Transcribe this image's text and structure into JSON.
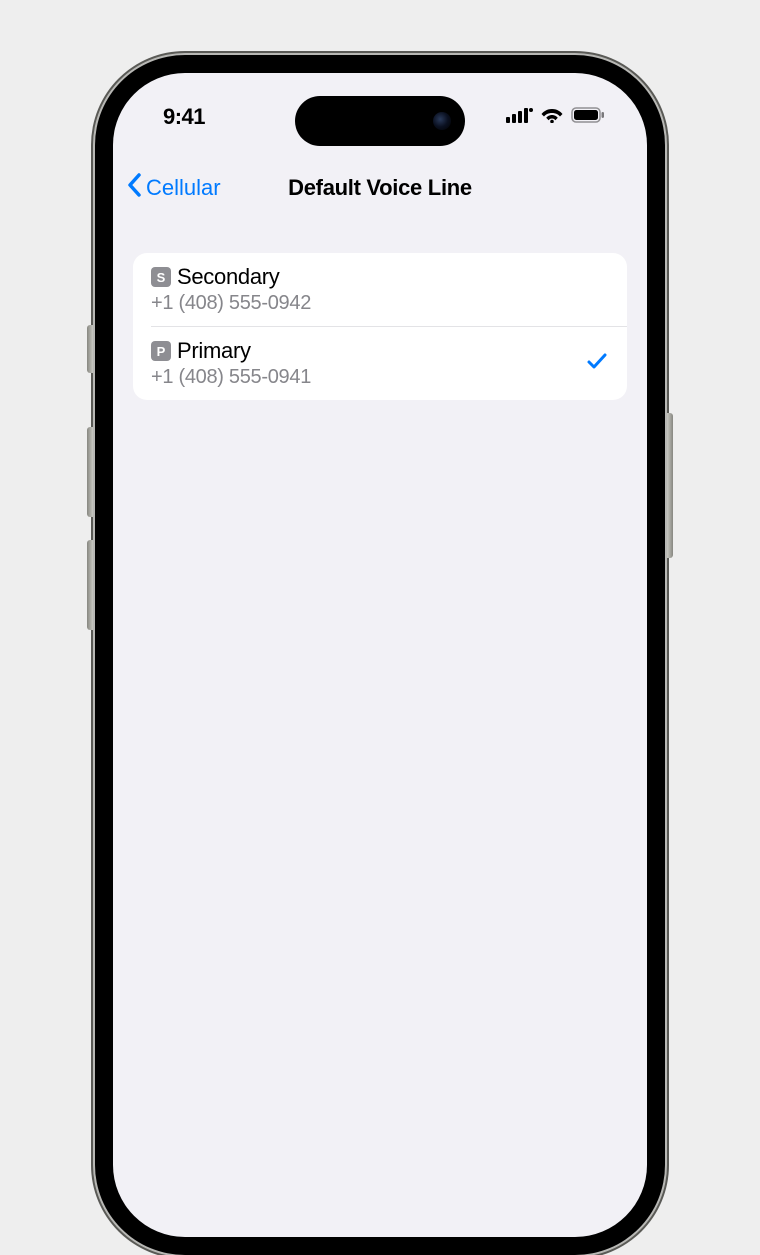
{
  "status": {
    "time": "9:41"
  },
  "nav": {
    "back_label": "Cellular",
    "title": "Default Voice Line"
  },
  "lines": [
    {
      "badge": "S",
      "badge_name": "sim-badge-secondary",
      "label": "Secondary",
      "number": "+1 (408) 555-0942",
      "selected": false
    },
    {
      "badge": "P",
      "badge_name": "sim-badge-primary",
      "label": "Primary",
      "number": "+1 (408) 555-0941",
      "selected": true
    }
  ]
}
